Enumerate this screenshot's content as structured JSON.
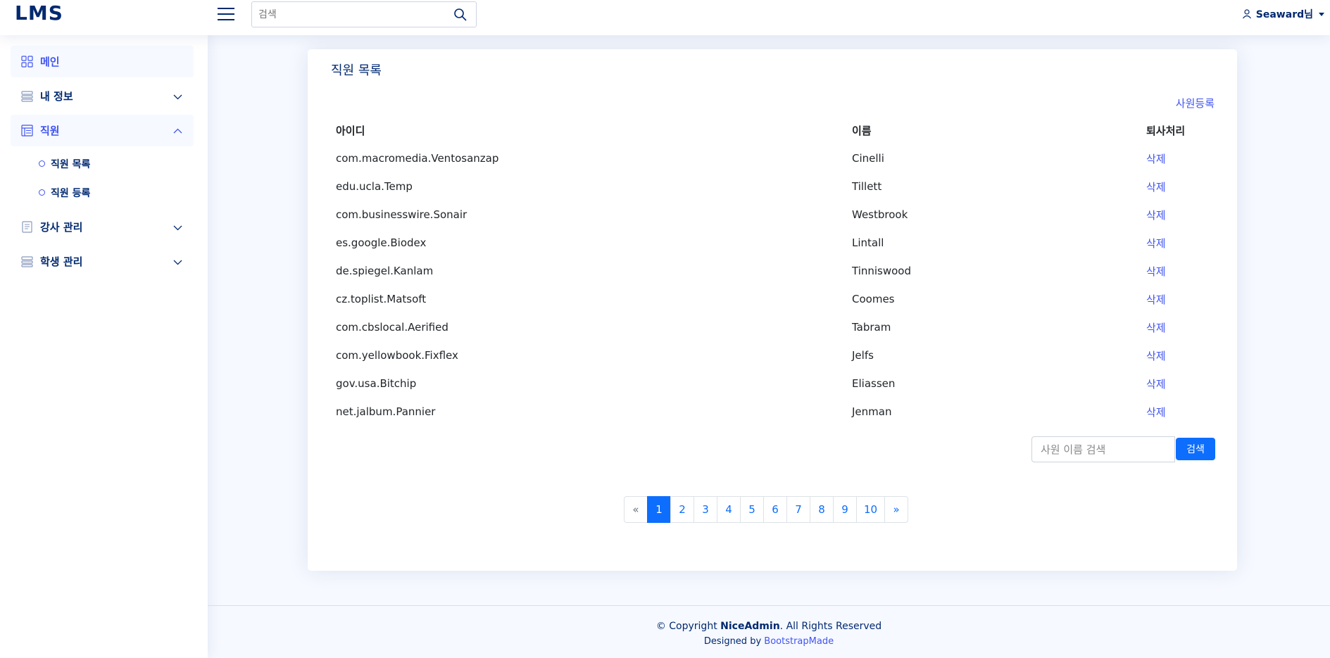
{
  "header": {
    "logo": "LMS",
    "search_placeholder": "검색",
    "user_name": "Seaward님"
  },
  "sidebar": {
    "items": [
      {
        "label": "메인"
      },
      {
        "label": "내 정보"
      },
      {
        "label": "직원"
      },
      {
        "label": "강사 관리"
      },
      {
        "label": "학생 관리"
      }
    ],
    "sub_items": [
      {
        "label": "직원 목록"
      },
      {
        "label": "직원 등록"
      }
    ]
  },
  "main": {
    "title": "직원 목록",
    "register_label": "사원등록",
    "columns": [
      "아이디",
      "이름",
      "퇴사처리"
    ],
    "rows": [
      {
        "id": "com.macromedia.Ventosanzap",
        "name": "Cinelli",
        "action": "삭제"
      },
      {
        "id": "edu.ucla.Temp",
        "name": "Tillett",
        "action": "삭제"
      },
      {
        "id": "com.businesswire.Sonair",
        "name": "Westbrook",
        "action": "삭제"
      },
      {
        "id": "es.google.Biodex",
        "name": "Lintall",
        "action": "삭제"
      },
      {
        "id": "de.spiegel.Kanlam",
        "name": "Tinniswood",
        "action": "삭제"
      },
      {
        "id": "cz.toplist.Matsoft",
        "name": "Coomes",
        "action": "삭제"
      },
      {
        "id": "com.cbslocal.Aerified",
        "name": "Tabram",
        "action": "삭제"
      },
      {
        "id": "com.yellowbook.Fixflex",
        "name": "Jelfs",
        "action": "삭제"
      },
      {
        "id": "gov.usa.Bitchip",
        "name": "Eliassen",
        "action": "삭제"
      },
      {
        "id": "net.jalbum.Pannier",
        "name": "Jenman",
        "action": "삭제"
      }
    ],
    "name_search_placeholder": "사원 이름 검색",
    "name_search_button": "검색",
    "pagination": {
      "prev": "«",
      "pages": [
        "1",
        "2",
        "3",
        "4",
        "5",
        "6",
        "7",
        "8",
        "9",
        "10"
      ],
      "next": "»",
      "current": "1"
    }
  },
  "footer": {
    "copyright_prefix": "© Copyright ",
    "brand": "NiceAdmin",
    "copyright_suffix": ". All Rights Reserved",
    "designed_by": "Designed by ",
    "designer": "BootstrapMade"
  },
  "colors": {
    "accent": "#4154f1",
    "navy": "#012970",
    "button_blue": "#0d6efd",
    "background": "#f6f9ff"
  }
}
